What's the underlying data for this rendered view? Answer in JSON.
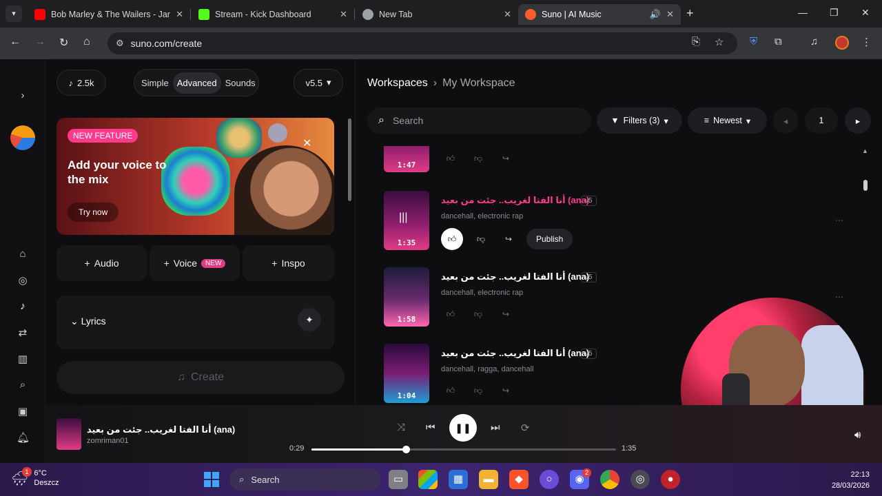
{
  "browser": {
    "tabs": [
      {
        "title": "Bob Marley & The Wailers - Jam",
        "favicon_color": "#ff0000"
      },
      {
        "title": "Stream - Kick Dashboard",
        "favicon_color": "#53fc18"
      },
      {
        "title": "New Tab",
        "favicon_color": "#9aa0a6"
      },
      {
        "title": "Suno | AI Music",
        "favicon_color": "#ff5b2e"
      }
    ],
    "url": "suno.com/create"
  },
  "composer": {
    "credits": "2.5k",
    "modes": [
      "Simple",
      "Advanced",
      "Sounds"
    ],
    "active_mode": "Advanced",
    "model": "v5.5",
    "banner": {
      "badge": "NEW FEATURE",
      "headline": "Add your voice to the mix",
      "cta": "Try now"
    },
    "add_buttons": {
      "audio": "Audio",
      "voice": "Voice",
      "voice_badge": "NEW",
      "inspo": "Inspo"
    },
    "lyrics_label": "Lyrics",
    "create_label": "Create"
  },
  "workspace": {
    "root": "Workspaces",
    "current": "My Workspace",
    "search_placeholder": "Search",
    "filters_label": "Filters (3)",
    "sort_label": "Newest",
    "page": "1",
    "songs": [
      {
        "title": "",
        "version": "",
        "tags": "",
        "duration": "1:47",
        "playing": false
      },
      {
        "title": "أنا الفتا لغريب.. جئت من بعيد (ana)",
        "version": "v5",
        "tags": "dancehall, electronic rap",
        "duration": "1:35",
        "playing": true,
        "publish": "Publish"
      },
      {
        "title": "أنا الفتا لغريب.. جئت من بعيد (ana)",
        "version": "v5",
        "tags": "dancehall, electronic rap",
        "duration": "1:58",
        "playing": false
      },
      {
        "title": "أنا الفتا لغريب.. جئت من بعيد (ana)",
        "version": "v5",
        "tags": "dancehall, ragga, dancehall",
        "duration": "1:04",
        "playing": false
      }
    ]
  },
  "player": {
    "title": "أنا الفتا لغريب.. جئت من بعيد (ana)",
    "artist": "zomriman01",
    "elapsed": "0:29",
    "total": "1:35",
    "progress": 0.31
  },
  "taskbar": {
    "temperature": "6°C",
    "condition": "Deszcz",
    "search_label": "Search",
    "weather_badge": "1",
    "discord_badge": "2",
    "time": "22:13",
    "date": "28/03/2026"
  },
  "colors": {
    "accent": "#ff3a8c",
    "taskbar": "#3d2470"
  }
}
